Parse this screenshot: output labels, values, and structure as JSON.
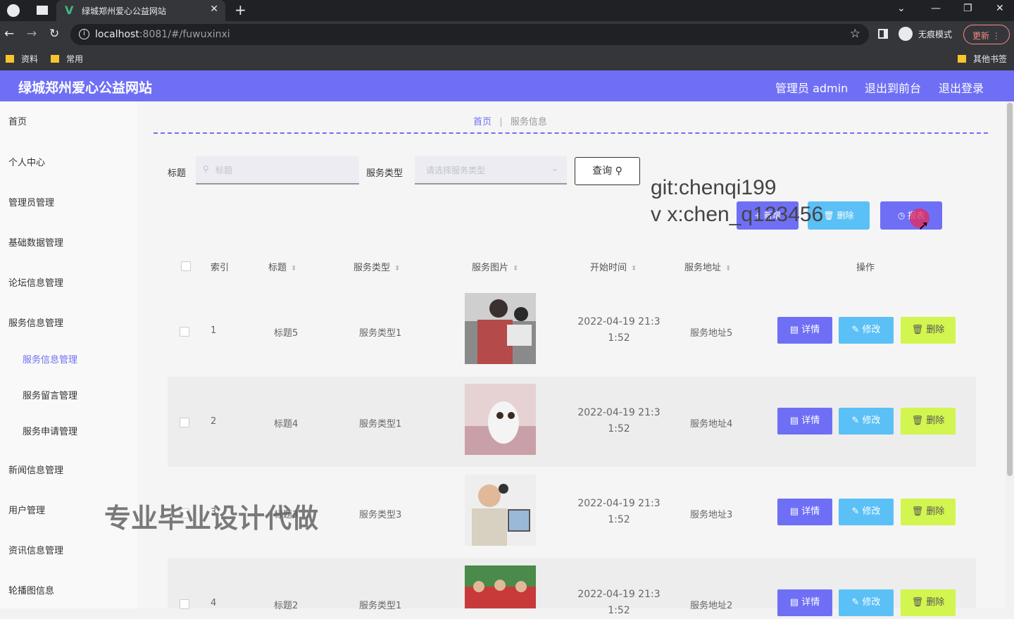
{
  "browser": {
    "tab_title": "绿城郑州爱心公益网站",
    "url_host": "localhost",
    "url_path": ":8081/#/fuwuxinxi",
    "incognito_label": "无痕模式",
    "update_label": "更新",
    "bookmarks": [
      "资料",
      "常用"
    ],
    "other_bookmarks": "其他书签"
  },
  "header": {
    "title": "绿城郑州爱心公益网站",
    "admin_label": "管理员 admin",
    "to_front": "退出到前台",
    "logout": "退出登录"
  },
  "sidebar": {
    "items": [
      "首页",
      "个人中心",
      "管理员管理",
      "基础数据管理",
      "论坛信息管理",
      "服务信息管理"
    ],
    "sub_items": [
      "服务信息管理",
      "服务留言管理",
      "服务申请管理"
    ],
    "items_after": [
      "新闻信息管理",
      "用户管理",
      "资讯信息管理",
      "轮播图信息"
    ]
  },
  "breadcrumb": {
    "home": "首页",
    "current": "服务信息"
  },
  "search": {
    "title_label": "标题",
    "title_placeholder": "标题",
    "type_label": "服务类型",
    "type_placeholder": "请选择服务类型",
    "query_button": "查询"
  },
  "actions": {
    "add": "新增",
    "delete": "删除",
    "report": "报表"
  },
  "overlay": {
    "line1": "git:chenqi199",
    "line2": "v x:chen_q123456",
    "watermark": "专业毕业设计代做"
  },
  "table": {
    "headers": {
      "index": "索引",
      "title": "标题",
      "type": "服务类型",
      "image": "服务图片",
      "start": "开始时间",
      "address": "服务地址",
      "ops": "操作"
    },
    "rows": [
      {
        "index": "1",
        "title": "标题5",
        "type": "服务类型1",
        "time1": "2022-04-19 21:3",
        "time2": "1:52",
        "address": "服务地址5"
      },
      {
        "index": "2",
        "title": "标题4",
        "type": "服务类型1",
        "time1": "2022-04-19 21:3",
        "time2": "1:52",
        "address": "服务地址4"
      },
      {
        "index": "3",
        "title": "标题3",
        "type": "服务类型3",
        "time1": "2022-04-19 21:3",
        "time2": "1:52",
        "address": "服务地址3"
      },
      {
        "index": "4",
        "title": "标题2",
        "type": "服务类型1",
        "time1": "2022-04-19 21:3",
        "time2": "1:52",
        "address": "服务地址2"
      }
    ],
    "row_buttons": {
      "detail": "详情",
      "edit": "修改",
      "delete": "删除"
    }
  },
  "colors": {
    "accent": "#6f6ff6",
    "edit": "#5bc0f5",
    "delete": "#d2f54f"
  }
}
